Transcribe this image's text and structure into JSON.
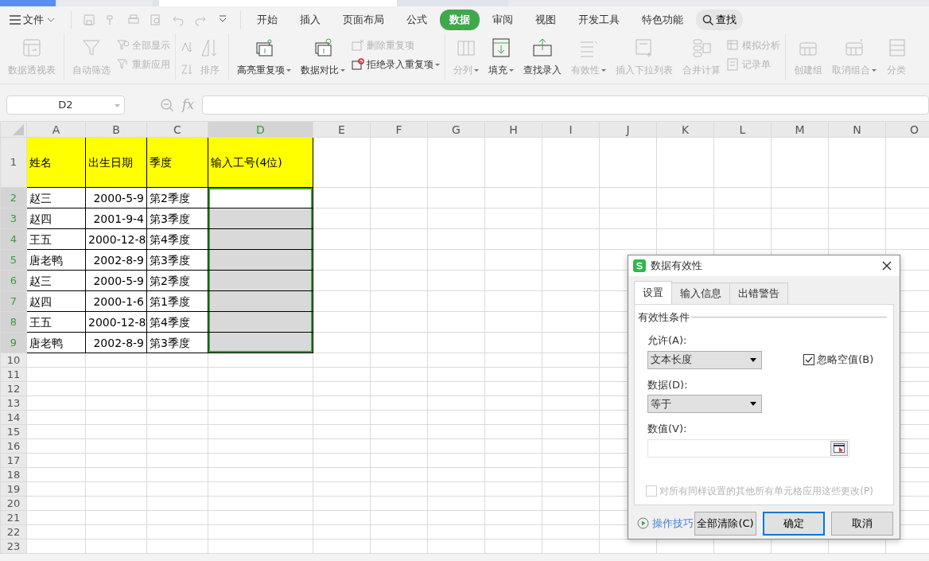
{
  "menu": {
    "file": "文件",
    "tabs": [
      {
        "label": "开始",
        "selected": false
      },
      {
        "label": "插入",
        "selected": false
      },
      {
        "label": "页面布局",
        "selected": false
      },
      {
        "label": "公式",
        "selected": false
      },
      {
        "label": "数据",
        "selected": true
      },
      {
        "label": "审阅",
        "selected": false
      },
      {
        "label": "视图",
        "selected": false
      },
      {
        "label": "开发工具",
        "selected": false
      },
      {
        "label": "特色功能",
        "selected": false
      }
    ],
    "search": "查找"
  },
  "ribbon": {
    "groups": [
      {
        "items": [
          {
            "kind": "large",
            "label": "数据透视表",
            "disabled": true,
            "dropdown": false
          }
        ]
      },
      {
        "items": [
          {
            "kind": "large",
            "label": "自动筛选",
            "disabled": true,
            "dropdown": false
          },
          {
            "kind": "small",
            "label": "全部显示",
            "disabled": true,
            "dropdown": false
          },
          {
            "kind": "small",
            "label": "重新应用",
            "disabled": true,
            "dropdown": false
          }
        ]
      },
      {
        "items": [
          {
            "kind": "icon",
            "disabled": true
          },
          {
            "kind": "icon",
            "disabled": true
          },
          {
            "kind": "large",
            "label": "排序",
            "disabled": true,
            "dropdown": false
          }
        ]
      },
      {
        "items": [
          {
            "kind": "large",
            "label": "高亮重复项",
            "disabled": false,
            "dropdown": true
          },
          {
            "kind": "large",
            "label": "数据对比",
            "disabled": false,
            "dropdown": true
          },
          {
            "kind": "small",
            "label": "删除重复项",
            "disabled": true,
            "dropdown": false
          },
          {
            "kind": "small",
            "label": "拒绝录入重复项",
            "disabled": false,
            "dropdown": true
          }
        ]
      },
      {
        "items": [
          {
            "kind": "large",
            "label": "分列",
            "disabled": true,
            "dropdown": true
          },
          {
            "kind": "large",
            "label": "填充",
            "disabled": false,
            "dropdown": true
          },
          {
            "kind": "large",
            "label": "查找录入",
            "disabled": false,
            "dropdown": false
          },
          {
            "kind": "large",
            "label": "有效性",
            "disabled": true,
            "dropdown": true
          },
          {
            "kind": "large",
            "label": "插入下拉列表",
            "disabled": true,
            "dropdown": false
          },
          {
            "kind": "large",
            "label": "合并计算",
            "disabled": true,
            "dropdown": false
          },
          {
            "kind": "small",
            "label": "模拟分析",
            "disabled": true,
            "dropdown": false
          },
          {
            "kind": "small",
            "label": "记录单",
            "disabled": true,
            "dropdown": false
          }
        ]
      },
      {
        "items": [
          {
            "kind": "large",
            "label": "创建组",
            "disabled": true,
            "dropdown": false
          },
          {
            "kind": "large",
            "label": "取消组合",
            "disabled": true,
            "dropdown": true
          },
          {
            "kind": "large",
            "label": "分类",
            "disabled": true,
            "dropdown": false
          }
        ]
      }
    ]
  },
  "formula_bar": {
    "name_box": "D2",
    "fx": "fx"
  },
  "sheet": {
    "columns": [
      {
        "label": "A",
        "selected": false
      },
      {
        "label": "B",
        "selected": false
      },
      {
        "label": "C",
        "selected": false
      },
      {
        "label": "D",
        "selected": true
      },
      {
        "label": "E",
        "selected": false
      },
      {
        "label": "F",
        "selected": false
      },
      {
        "label": "G",
        "selected": false
      },
      {
        "label": "H",
        "selected": false
      },
      {
        "label": "I",
        "selected": false
      },
      {
        "label": "J",
        "selected": false
      },
      {
        "label": "K",
        "selected": false
      },
      {
        "label": "L",
        "selected": false
      },
      {
        "label": "M",
        "selected": false
      },
      {
        "label": "N",
        "selected": false
      },
      {
        "label": "O",
        "selected": false
      }
    ],
    "rows": [
      {
        "label": "1",
        "selected": false,
        "cells": [
          "姓名",
          "出生日期",
          "季度",
          "输入工号(4位)"
        ]
      },
      {
        "label": "2",
        "selected": true,
        "cells": [
          "赵三",
          "2000-5-9",
          "第2季度",
          ""
        ]
      },
      {
        "label": "3",
        "selected": true,
        "cells": [
          "赵四",
          "2001-9-4",
          "第3季度",
          ""
        ]
      },
      {
        "label": "4",
        "selected": true,
        "cells": [
          "王五",
          "2000-12-8",
          "第4季度",
          ""
        ]
      },
      {
        "label": "5",
        "selected": true,
        "cells": [
          "唐老鸭",
          "2002-8-9",
          "第3季度",
          ""
        ]
      },
      {
        "label": "6",
        "selected": true,
        "cells": [
          "赵三",
          "2000-5-9",
          "第2季度",
          ""
        ]
      },
      {
        "label": "7",
        "selected": true,
        "cells": [
          "赵四",
          "2000-1-6",
          "第1季度",
          ""
        ]
      },
      {
        "label": "8",
        "selected": true,
        "cells": [
          "王五",
          "2000-12-8",
          "第4季度",
          ""
        ]
      },
      {
        "label": "9",
        "selected": true,
        "cells": [
          "唐老鸭",
          "2002-8-9",
          "第3季度",
          ""
        ]
      },
      {
        "label": "10",
        "selected": false
      },
      {
        "label": "11",
        "selected": false
      },
      {
        "label": "12",
        "selected": false
      },
      {
        "label": "13",
        "selected": false
      },
      {
        "label": "14",
        "selected": false
      },
      {
        "label": "15",
        "selected": false
      },
      {
        "label": "16",
        "selected": false
      },
      {
        "label": "17",
        "selected": false
      },
      {
        "label": "18",
        "selected": false
      },
      {
        "label": "19",
        "selected": false
      },
      {
        "label": "20",
        "selected": false
      },
      {
        "label": "21",
        "selected": false
      },
      {
        "label": "22",
        "selected": false
      },
      {
        "label": "23",
        "selected": false
      }
    ]
  },
  "dialog": {
    "title": "数据有效性",
    "tabs": [
      {
        "label": "设置",
        "selected": true
      },
      {
        "label": "输入信息",
        "selected": false
      },
      {
        "label": "出错警告",
        "selected": false
      }
    ],
    "section": "有效性条件",
    "allow": {
      "label": "允许(A):",
      "value": "文本长度"
    },
    "ignore_blank": {
      "label": "忽略空值(B)",
      "checked": true
    },
    "data": {
      "label": "数据(D):",
      "value": "等于"
    },
    "value": {
      "label": "数值(V):"
    },
    "apply_all": {
      "label": "对所有同样设置的其他所有单元格应用这些更改(P)",
      "checked": false,
      "disabled": true
    },
    "help": "操作技巧",
    "buttons": [
      {
        "label": "全部清除(C)",
        "default": false
      },
      {
        "label": "确定",
        "default": true
      },
      {
        "label": "取消",
        "default": false
      }
    ]
  }
}
